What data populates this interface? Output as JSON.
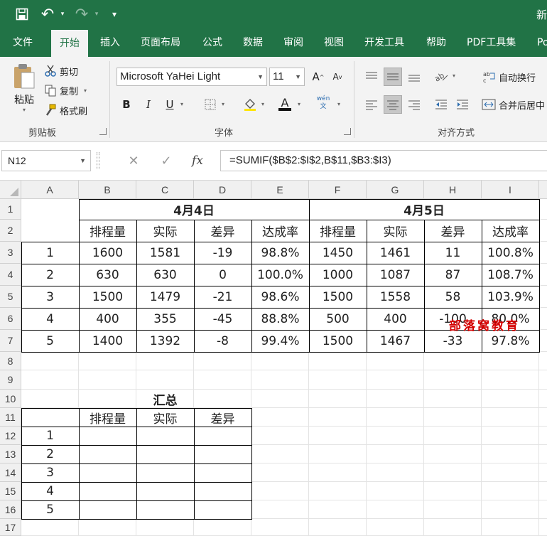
{
  "title_bar": {
    "doc_title": "新",
    "undo_label": "↶",
    "redo_label": "↷",
    "customize_label": "▾"
  },
  "tabs": [
    "文件",
    "开始",
    "插入",
    "页面布局",
    "公式",
    "数据",
    "审阅",
    "视图",
    "开发工具",
    "帮助",
    "PDF工具集",
    "Po"
  ],
  "ribbon": {
    "clipboard": {
      "paste": "粘贴",
      "cut": "剪切",
      "copy": "复制",
      "format_painter": "格式刷",
      "label": "剪贴板"
    },
    "font": {
      "font_name": "Microsoft YaHei Light",
      "font_size": "11",
      "label": "字体",
      "bold": "B",
      "italic": "I",
      "underline": "U",
      "grow": "A",
      "shrink": "A",
      "font_color": "A",
      "phonetic": "wén 文"
    },
    "alignment": {
      "wrap_text": "自动换行",
      "merge_center": "合并后居中",
      "label": "对齐方式"
    }
  },
  "formula_bar": {
    "name_box": "N12",
    "fx": "fx",
    "formula": "=SUMIF($B$2:$I$2,B$11,$B3:$I3)"
  },
  "columns": [
    "A",
    "B",
    "C",
    "D",
    "E",
    "F",
    "G",
    "H",
    "I"
  ],
  "rows": [
    "1",
    "2",
    "3",
    "4",
    "5",
    "6",
    "7",
    "8",
    "9",
    "10",
    "11",
    "12",
    "13",
    "14",
    "15",
    "16",
    "17"
  ],
  "sheet": {
    "date1": "4月4日",
    "date2": "4月5日",
    "headers": [
      "排程量",
      "实际",
      "差异",
      "达成率",
      "排程量",
      "实际",
      "差异",
      "达成率"
    ],
    "data": [
      [
        "1",
        "1600",
        "1581",
        "-19",
        "98.8%",
        "1450",
        "1461",
        "11",
        "100.8%"
      ],
      [
        "2",
        "630",
        "630",
        "0",
        "100.0%",
        "1000",
        "1087",
        "87",
        "108.7%"
      ],
      [
        "3",
        "1500",
        "1479",
        "-21",
        "98.6%",
        "1500",
        "1558",
        "58",
        "103.9%"
      ],
      [
        "4",
        "400",
        "355",
        "-45",
        "88.8%",
        "500",
        "400",
        "-100",
        "80.0%"
      ],
      [
        "5",
        "1400",
        "1392",
        "-8",
        "99.4%",
        "1500",
        "1467",
        "-33",
        "97.8%"
      ]
    ],
    "summary_title": "汇总",
    "summary_headers": [
      "排程量",
      "实际",
      "差异"
    ],
    "summary_ids": [
      "1",
      "2",
      "3",
      "4",
      "5"
    ]
  },
  "watermark": "部落窝教育"
}
